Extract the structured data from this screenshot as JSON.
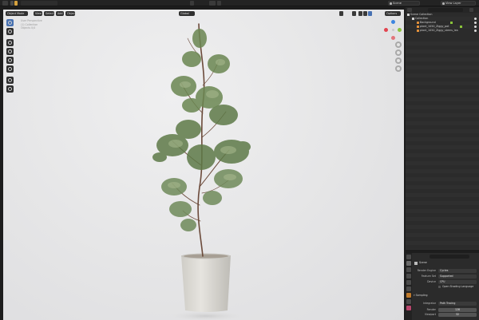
{
  "topbar": {
    "scene_field": "Scene",
    "view_layer_field": "View Layer"
  },
  "viewport": {
    "mode_label": "Object Mode",
    "menus": [
      "View",
      "Select",
      "Add",
      "Object"
    ],
    "transform_orientation": "Global",
    "options_label": "Options",
    "info_lines": [
      "User Perspective",
      "(1) Collection",
      "Objects 0/4"
    ]
  },
  "outliner": {
    "rows": [
      {
        "label": "Scene Collection",
        "icon": "collection-icon"
      },
      {
        "label": "Collection",
        "icon": "collection-icon"
      },
      {
        "label": "Background",
        "icon": "object-icon"
      },
      {
        "label": "plant_1050_Ziggy_pot",
        "icon": "object-icon"
      },
      {
        "label": "plant_1050_Ziggy_stems_lea",
        "icon": "object-icon"
      }
    ]
  },
  "properties": {
    "breadcrumb": "Scene",
    "render_engine_label": "Render Engine",
    "render_engine_value": "Cycles",
    "feature_set_label": "Feature Set",
    "feature_set_value": "Supported",
    "device_label": "Device",
    "device_value": "CPU",
    "osl_label": "Open Shading Language",
    "sampling_label": "Sampling",
    "integrator_label": "Integrator",
    "integrator_value": "Path Tracing",
    "render_label": "Render",
    "render_value": "128",
    "viewport_label": "Viewport",
    "viewport_value": "32"
  },
  "colors": {
    "accent_blue": "#4771b2",
    "axis_x": "#e2444f",
    "axis_y": "#8ac33a",
    "axis_z": "#3d85e0",
    "leaf_green": "#5e7a48",
    "stem_brown": "#6b4a3a",
    "pot": "#d9d7d1"
  }
}
